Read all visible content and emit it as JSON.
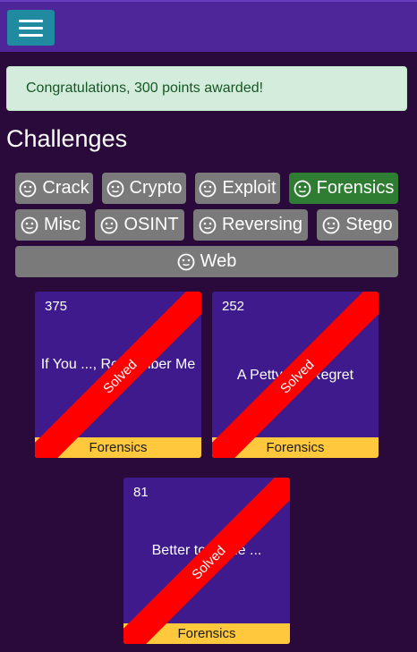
{
  "navbar": {
    "menu_icon": "hamburger-menu-icon",
    "color": "#4f2699"
  },
  "alert": {
    "message": "Congratulations, 300 points awarded!"
  },
  "page": {
    "title": "Challenges"
  },
  "categories": [
    {
      "label": "Crack",
      "icon": "smiley-icon",
      "active": false
    },
    {
      "label": "Crypto",
      "icon": "smiley-icon",
      "active": false
    },
    {
      "label": "Exploit",
      "icon": "smiley-icon",
      "active": false
    },
    {
      "label": "Forensics",
      "icon": "smiley-icon",
      "active": true
    },
    {
      "label": "Misc",
      "icon": "smiley-icon",
      "active": false
    },
    {
      "label": "OSINT",
      "icon": "smiley-icon",
      "active": false
    },
    {
      "label": "Reversing",
      "icon": "smiley-icon",
      "active": false
    },
    {
      "label": "Stego",
      "icon": "smiley-icon",
      "active": false
    },
    {
      "label": "Web",
      "icon": "smiley-icon",
      "active": false
    }
  ],
  "challenges": [
    {
      "points": "375",
      "title": "If You ..., Remember Me",
      "category": "Forensics",
      "status": "Solved"
    },
    {
      "points": "252",
      "title": "A Petty V... Regret",
      "category": "Forensics",
      "status": "Solved"
    },
    {
      "points": "81",
      "title": "Better to ... the ...",
      "category": "Forensics",
      "status": "Solved"
    }
  ],
  "colors": {
    "background": "#2a0a3a",
    "card": "#3e1a8c",
    "category_bar": "#ffc83d",
    "solved_band": "#ff0000",
    "active_category": "#2e7d32",
    "category_button": "#7a7a7a"
  }
}
